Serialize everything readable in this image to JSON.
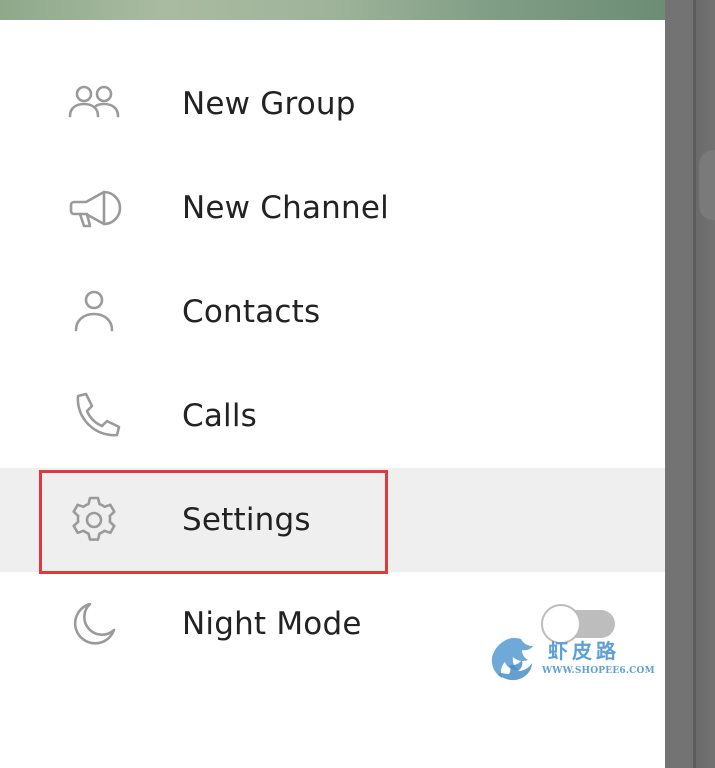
{
  "menu": {
    "items": [
      {
        "label": "New Group",
        "icon": "people-icon"
      },
      {
        "label": "New Channel",
        "icon": "megaphone-icon"
      },
      {
        "label": "Contacts",
        "icon": "person-icon"
      },
      {
        "label": "Calls",
        "icon": "phone-icon"
      },
      {
        "label": "Settings",
        "icon": "gear-icon",
        "active": true
      },
      {
        "label": "Night Mode",
        "icon": "moon-icon",
        "toggle": false
      }
    ]
  },
  "colors": {
    "icon_stroke": "#9a9a9a",
    "label_text": "#222222",
    "active_bg": "#efefef",
    "highlight_border": "#e0393e",
    "toggle_off": "#bdbdbd",
    "watermark": "#5fa0d4"
  },
  "watermark": {
    "text_cn": "虾皮路",
    "url": "WWW.SHOPEE6.COM"
  }
}
